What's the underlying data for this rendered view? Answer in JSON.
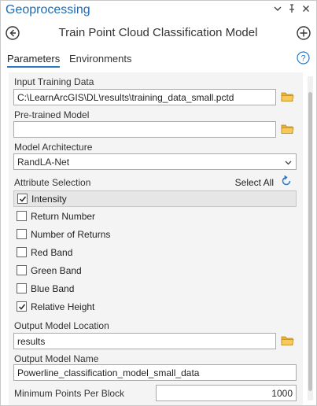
{
  "app": {
    "title": "Geoprocessing",
    "window_controls": [
      "chevron-down-icon",
      "pin-icon",
      "close-icon"
    ]
  },
  "tool": {
    "title": "Train Point Cloud Classification Model"
  },
  "tabs": [
    {
      "label": "Parameters",
      "active": true
    },
    {
      "label": "Environments",
      "active": false
    }
  ],
  "params": {
    "input_training_data": {
      "label": "Input Training Data",
      "value": "C:\\LearnArcGIS\\DL\\results\\training_data_small.pctd"
    },
    "pretrained_model": {
      "label": "Pre-trained Model",
      "value": ""
    },
    "model_architecture": {
      "label": "Model Architecture",
      "value": "RandLA-Net"
    },
    "attribute_selection": {
      "label": "Attribute Selection",
      "select_all_label": "Select All",
      "items": [
        {
          "label": "Intensity",
          "checked": true,
          "highlighted": true
        },
        {
          "label": "Return Number",
          "checked": false,
          "highlighted": false
        },
        {
          "label": "Number of Returns",
          "checked": false,
          "highlighted": false
        },
        {
          "label": "Red Band",
          "checked": false,
          "highlighted": false
        },
        {
          "label": "Green Band",
          "checked": false,
          "highlighted": false
        },
        {
          "label": "Blue Band",
          "checked": false,
          "highlighted": false
        },
        {
          "label": "Relative Height",
          "checked": true,
          "highlighted": false
        }
      ]
    },
    "output_model_location": {
      "label": "Output Model Location",
      "value": "results"
    },
    "output_model_name": {
      "label": "Output Model Name",
      "value": "Powerline_classification_model_small_data"
    },
    "min_points_per_block": {
      "label": "Minimum Points Per Block",
      "value": "1000"
    }
  },
  "colors": {
    "accent": "#1d6bb5",
    "folder": "#e8b23a",
    "panel_bg": "#f4f4f4",
    "highlight": "#e6e6e6"
  }
}
